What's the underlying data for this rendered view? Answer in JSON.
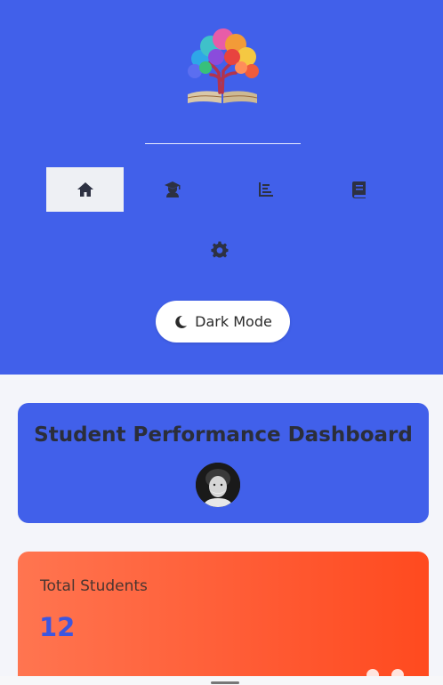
{
  "sidebar": {
    "logo_icon": "tree-book-logo",
    "nav": [
      {
        "id": "home",
        "icon": "home-icon",
        "active": true
      },
      {
        "id": "students",
        "icon": "graduate-icon",
        "active": false
      },
      {
        "id": "analytics",
        "icon": "chart-icon",
        "active": false
      },
      {
        "id": "courses",
        "icon": "book-icon",
        "active": false
      },
      {
        "id": "settings",
        "icon": "gear-icon",
        "active": false
      }
    ],
    "dark_mode_label": "Dark Mode",
    "dark_mode_icon": "moon-icon"
  },
  "header": {
    "title": "Student Performance Dashboard",
    "avatar_icon": "user-avatar"
  },
  "stats": [
    {
      "label": "Total Students",
      "value": "12"
    }
  ],
  "colors": {
    "primary": "#4160ea",
    "background": "#f4f5fa",
    "stat_gradient_start": "#ff7550",
    "stat_gradient_end": "#ff4a1f",
    "stat_value": "#3d56e0"
  }
}
